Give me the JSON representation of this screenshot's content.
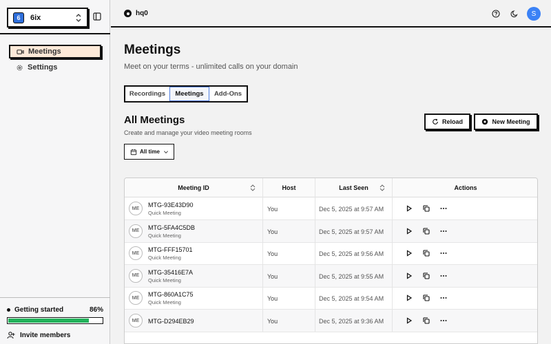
{
  "workspace": {
    "badge": "6",
    "name": "6ix"
  },
  "sidebar": {
    "items": [
      {
        "label": "Meetings",
        "icon": "video-icon",
        "active": true
      },
      {
        "label": "Settings",
        "icon": "gear-icon",
        "active": false
      }
    ],
    "getting_started": {
      "label": "Getting started",
      "percent_text": "86%",
      "progress": 0.86
    },
    "invite_label": "Invite members"
  },
  "topbar": {
    "brand": "hq0",
    "avatar_initial": "S"
  },
  "page": {
    "title": "Meetings",
    "subtitle": "Meet on your terms - unlimited calls on your domain"
  },
  "tabs": [
    "Recordings",
    "Meetings",
    "Add-Ons"
  ],
  "section": {
    "title": "All Meetings",
    "subtitle": "Create and manage your video meeting rooms",
    "reload_label": "Reload",
    "new_label": "New Meeting",
    "filter_label": "All time"
  },
  "table": {
    "columns": [
      "Meeting ID",
      "Host",
      "Last Seen",
      "Actions"
    ],
    "rows": [
      {
        "badge": "ME",
        "id": "MTG-93E43D90",
        "type": "Quick Meeting",
        "host": "You",
        "last_seen": "Dec 5, 2025 at 9:57 AM"
      },
      {
        "badge": "ME",
        "id": "MTG-5FA4C5DB",
        "type": "Quick Meeting",
        "host": "You",
        "last_seen": "Dec 5, 2025 at 9:57 AM"
      },
      {
        "badge": "ME",
        "id": "MTG-FFF15701",
        "type": "Quick Meeting",
        "host": "You",
        "last_seen": "Dec 5, 2025 at 9:56 AM"
      },
      {
        "badge": "ME",
        "id": "MTG-35416E7A",
        "type": "Quick Meeting",
        "host": "You",
        "last_seen": "Dec 5, 2025 at 9:55 AM"
      },
      {
        "badge": "ME",
        "id": "MTG-860A1C75",
        "type": "Quick Meeting",
        "host": "You",
        "last_seen": "Dec 5, 2025 at 9:54 AM"
      },
      {
        "badge": "ME",
        "id": "MTG-D294EB29",
        "type": "",
        "host": "You",
        "last_seen": "Dec 5, 2025 at 9:36 AM"
      }
    ]
  },
  "colors": {
    "accent": "#3b82f6",
    "progress": "#22b35b",
    "active_nav": "#fde9d8"
  }
}
